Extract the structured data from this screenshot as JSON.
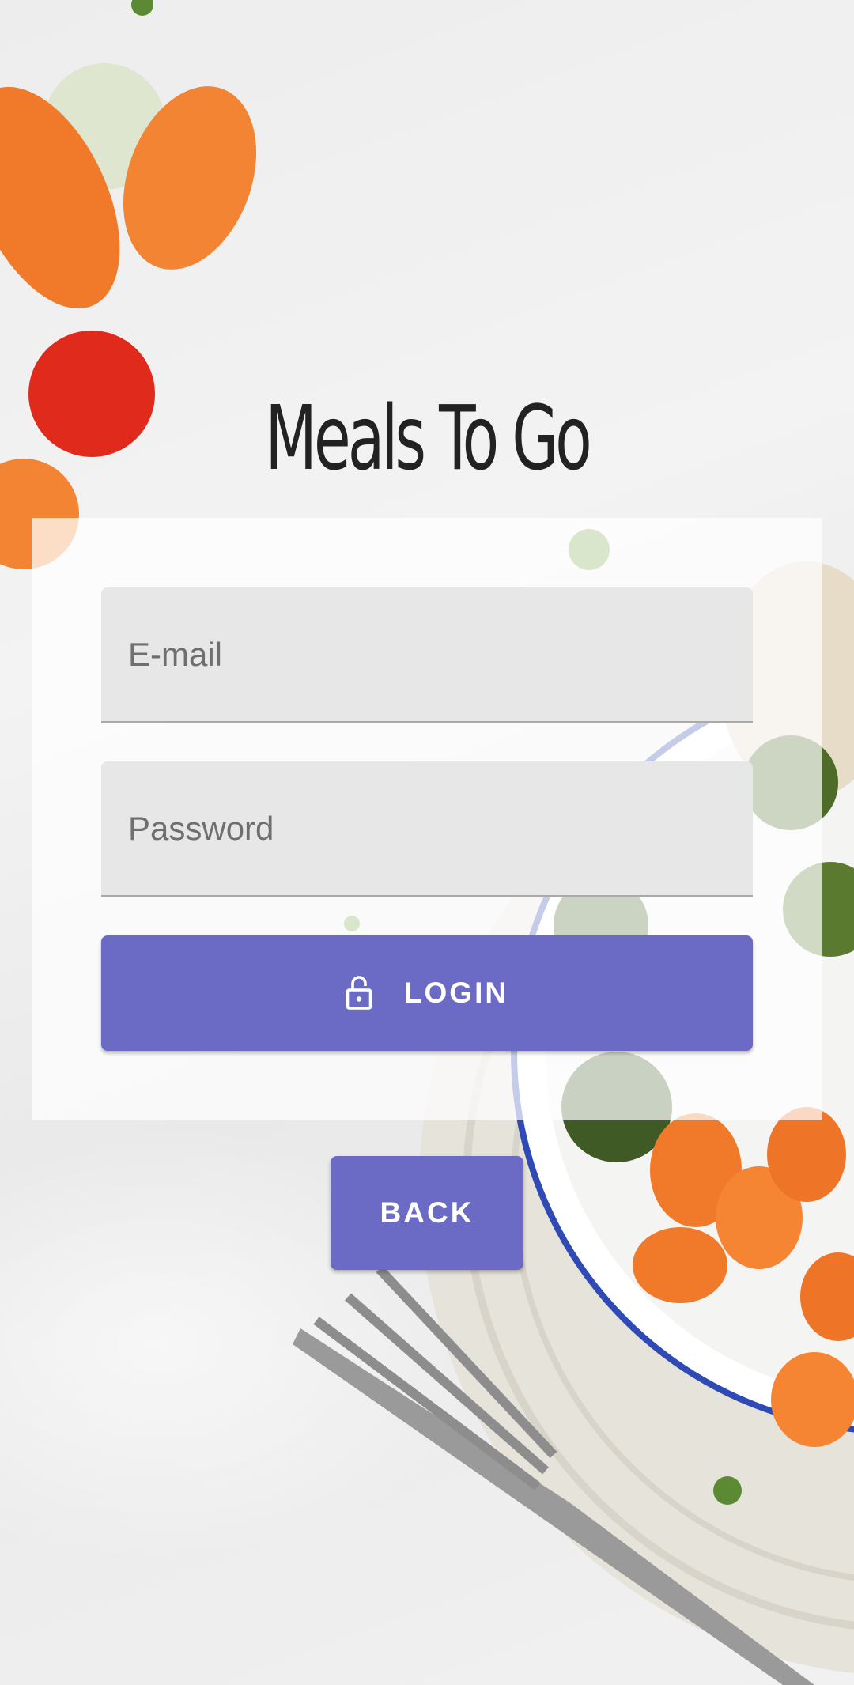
{
  "app": {
    "title": "Meals To Go"
  },
  "login_form": {
    "email": {
      "placeholder": "E-mail",
      "value": ""
    },
    "password": {
      "placeholder": "Password",
      "value": ""
    },
    "login_button": {
      "label": "LOGIN",
      "icon": "lock-open-icon"
    }
  },
  "back_button": {
    "label": "BACK"
  },
  "colors": {
    "primary": "#6b6bc5",
    "field_background": "#e7e7e7",
    "title_text": "#222222",
    "background": "#efefef"
  }
}
